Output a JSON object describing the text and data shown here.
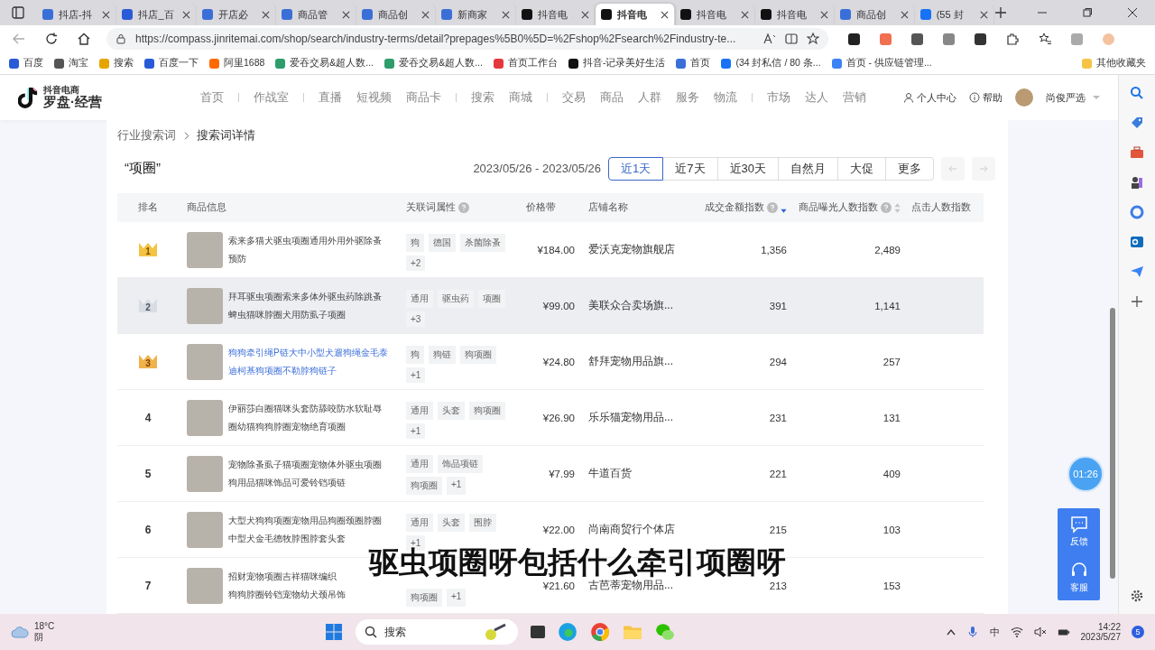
{
  "browser": {
    "tabs": [
      {
        "title": "抖店-抖",
        "selected": false,
        "kind": "doc"
      },
      {
        "title": "抖店_百",
        "selected": false,
        "kind": "paw"
      },
      {
        "title": "开店必",
        "selected": false,
        "kind": "doc"
      },
      {
        "title": "商品管",
        "selected": false,
        "kind": "doc"
      },
      {
        "title": "商品创",
        "selected": false,
        "kind": "doc"
      },
      {
        "title": "新商家",
        "selected": false,
        "kind": "doc"
      },
      {
        "title": "抖音电",
        "selected": false,
        "kind": "note"
      },
      {
        "title": "抖音电",
        "selected": true,
        "kind": "note"
      },
      {
        "title": "抖音电",
        "selected": false,
        "kind": "note"
      },
      {
        "title": "抖音电",
        "selected": false,
        "kind": "note"
      },
      {
        "title": "商品创",
        "selected": false,
        "kind": "doc"
      },
      {
        "title": "(55 封",
        "selected": false,
        "kind": "zhi"
      }
    ],
    "url": "https://compass.jinritemai.com/shop/search/industry-terms/detail?prepages%5B0%5D=%2Fshop%2Fsearch%2Findustry-te...",
    "bookmarks": [
      {
        "label": "百度",
        "kind": "paw"
      },
      {
        "label": "淘宝",
        "kind": "page"
      },
      {
        "label": "搜索",
        "kind": "round"
      },
      {
        "label": "百度一下",
        "kind": "paw"
      },
      {
        "label": "阿里1688",
        "kind": "ali"
      },
      {
        "label": "爱吞交易&超人数...",
        "kind": "leaf"
      },
      {
        "label": "爱吞交易&超人数...",
        "kind": "leaf"
      },
      {
        "label": "首页工作台",
        "kind": "red"
      },
      {
        "label": "抖音-记录美好生活",
        "kind": "note"
      },
      {
        "label": "首页",
        "kind": "doc"
      },
      {
        "label": "(34 封私信 / 80 条...",
        "kind": "zhi"
      },
      {
        "label": "首页 - 供应链管理...",
        "kind": "star"
      }
    ],
    "other_bookmarks": "其他收藏夹"
  },
  "header": {
    "logo_small": "抖音电商",
    "logo": "罗盘·经营",
    "nav_groups": [
      [
        "首页"
      ],
      [
        "作战室"
      ],
      [
        "直播",
        "短视频",
        "商品卡"
      ],
      [
        "搜索",
        "商城"
      ],
      [
        "交易",
        "商品",
        "人群",
        "服务",
        "物流"
      ],
      [
        "市场",
        "达人",
        "营销"
      ]
    ],
    "personal": "个人中心",
    "help": "帮助",
    "shop": "尚俊严选"
  },
  "breadcrumb": [
    "行业搜索词",
    "搜索词详情"
  ],
  "keyword": "“项圈”",
  "date_range": "2023/05/26 - 2023/05/26",
  "ranges": [
    {
      "label": "近1天",
      "selected": true
    },
    {
      "label": "近7天",
      "selected": false
    },
    {
      "label": "近30天",
      "selected": false
    },
    {
      "label": "自然月",
      "selected": false
    },
    {
      "label": "大促",
      "selected": false
    },
    {
      "label": "更多",
      "selected": false
    }
  ],
  "table": {
    "columns": [
      {
        "label": "排名",
        "help": false
      },
      {
        "label": "商品信息",
        "help": false
      },
      {
        "label": "关联词属性",
        "help": true
      },
      {
        "label": "价格带",
        "help": false
      },
      {
        "label": "店铺名称",
        "help": false
      },
      {
        "label": "成交金额指数",
        "help": true,
        "sortable": true,
        "sorted": true
      },
      {
        "label": "商品曝光人数指数",
        "help": true,
        "sortable": true,
        "sorted": false
      },
      {
        "label": "点击人数指数",
        "help": false
      }
    ],
    "rows": [
      {
        "rank": "1",
        "kind": "gold",
        "title_lines": [
          "索来多猫犬驱虫项圈通用外用外驱除蚤",
          "预防"
        ],
        "hovered": false,
        "shaded": false,
        "tags": [
          "狗",
          "德国",
          "杀菌除蚤",
          "+2"
        ],
        "price": "¥184.00",
        "shop": "爱沃克宠物旗舰店",
        "deal": "1,356",
        "exposure": "2,489"
      },
      {
        "rank": "2",
        "kind": "silver",
        "title_lines": [
          "拜耳驱虫项圈索来多体外驱虫药除跳蚤",
          "蜱虫猫咪脖圈犬用防虱子项圈"
        ],
        "hovered": false,
        "shaded": true,
        "tags": [
          "通用",
          "驱虫药",
          "项圈",
          "+3"
        ],
        "price": "¥99.00",
        "shop": "美联众合卖场旗...",
        "deal": "391",
        "exposure": "1,141"
      },
      {
        "rank": "3",
        "kind": "bronze",
        "title_lines": [
          "狗狗牵引绳P链大中小型犬遛狗绳金毛泰",
          "迪柯基狗项圈不勒脖狗链子"
        ],
        "hovered": true,
        "shaded": false,
        "tags": [
          "狗",
          "狗链",
          "狗项圈",
          "+1"
        ],
        "price": "¥24.80",
        "shop": "舒拜宠物用品旗...",
        "deal": "294",
        "exposure": "257"
      },
      {
        "rank": "4",
        "kind": "plain",
        "title_lines": [
          "伊丽莎白圈猫咪头套防舔咬防水软耻辱",
          "圈幼猫狗狗脖圈宠物绝育项圈"
        ],
        "hovered": false,
        "shaded": false,
        "tags": [
          "通用",
          "头套",
          "狗项圈",
          "+1"
        ],
        "price": "¥26.90",
        "shop": "乐乐猫宠物用品...",
        "deal": "231",
        "exposure": "131"
      },
      {
        "rank": "5",
        "kind": "plain",
        "title_lines": [
          "宠物除蚤虱子猫项圈宠物体外驱虫项圈",
          "狗用品猫咪饰品可爱铃铛项链"
        ],
        "hovered": false,
        "shaded": false,
        "tags": [
          "通用",
          "饰品项链",
          "狗项圈",
          "+1"
        ],
        "price": "¥7.99",
        "shop": "牛道百货",
        "deal": "221",
        "exposure": "409"
      },
      {
        "rank": "6",
        "kind": "plain",
        "title_lines": [
          "大型犬狗狗项圈宠物用品狗圈颈圈脖圈",
          "中型犬金毛德牧脖围脖套头套"
        ],
        "hovered": false,
        "shaded": false,
        "tags": [
          "通用",
          "头套",
          "围脖",
          "+1"
        ],
        "price": "¥22.00",
        "shop": "尚南商贸行个体店",
        "deal": "215",
        "exposure": "103"
      },
      {
        "rank": "7",
        "kind": "plain",
        "title_lines": [
          "招财宠物项圈吉祥猫咪编织",
          "狗狗脖圈铃铛宠物幼犬颈吊饰"
        ],
        "hovered": false,
        "shaded": false,
        "tags": [
          "狗项圈",
          "+1"
        ],
        "price": "¥21.60",
        "shop": "古芭蒂宠物用品...",
        "deal": "213",
        "exposure": "153"
      }
    ]
  },
  "timer": "01:26",
  "widget": [
    {
      "label": "反馈",
      "kind": "chat"
    },
    {
      "label": "客服",
      "kind": "headset"
    }
  ],
  "subtitle": "驱虫项圈呀包括什么牵引项圈呀",
  "taskbar": {
    "temperature": "18°C",
    "weather": "阴",
    "search": "搜索",
    "ime": "中",
    "time": "14:22",
    "date": "2023/5/27",
    "badge": "5"
  }
}
